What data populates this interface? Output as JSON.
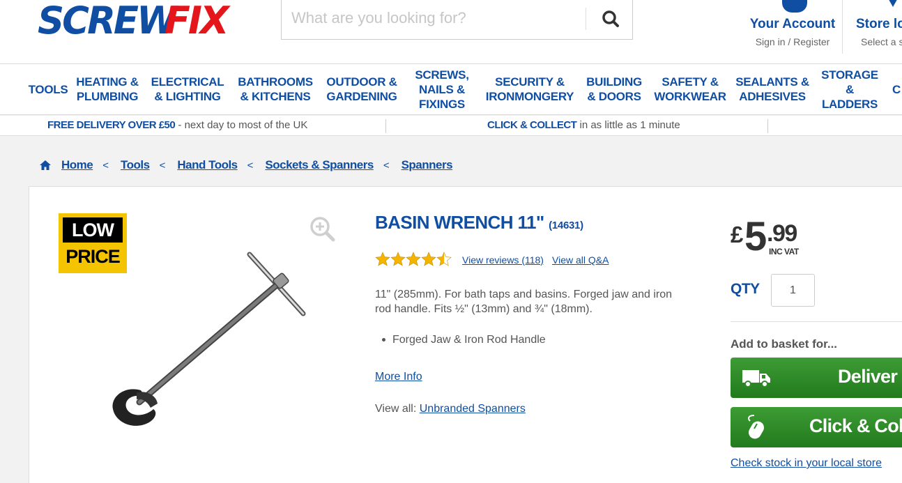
{
  "header": {
    "logo_left": "SCREW",
    "logo_right": "FIX",
    "search_placeholder": "What are you looking for?",
    "account_title": "Your Account",
    "account_sub": "Sign in / Register",
    "store_title": "Store locator",
    "store_sub": "Select a store"
  },
  "nav": {
    "items": [
      "TOOLS",
      "HEATING & PLUMBING",
      "ELECTRICAL & LIGHTING",
      "BATHROOMS & KITCHENS",
      "OUTDOOR & GARDENING",
      "SCREWS, NAILS & FIXINGS",
      "SECURITY & IRONMONGERY",
      "BUILDING & DOORS",
      "SAFETY & WORKWEAR",
      "SEALANTS & ADHESIVES",
      "STORAGE & LADDERS",
      "C"
    ]
  },
  "promo": {
    "delivery_bold": "FREE DELIVERY OVER £50",
    "delivery_rest": " - next day to most of the UK",
    "collect_bold": "CLICK & COLLECT",
    "collect_rest": " in as little as 1 minute"
  },
  "breadcrumb": {
    "items": [
      "Home",
      "Tools",
      "Hand Tools",
      "Sockets & Spanners",
      "Spanners"
    ],
    "separator": "<"
  },
  "badge": {
    "line1": "LOW",
    "line2": "PRICE"
  },
  "product": {
    "title": "BASIN WRENCH 11\"",
    "code": "(14631)",
    "rating": 4.5,
    "reviews_link": "View reviews (118)",
    "qa_link": "View all Q&A",
    "description": "11\" (285mm). For bath taps and basins. Forged jaw and iron rod handle. Fits ½\" (13mm) and ¾\" (18mm).",
    "bullets": [
      "Forged Jaw & Iron Rod Handle"
    ],
    "more_info": "More Info",
    "view_all_label": "View all: ",
    "view_all_link": "Unbranded Spanners"
  },
  "buy": {
    "currency": "£",
    "price_whole": "5",
    "price_pence": ".99",
    "vat": "INC VAT",
    "qty_label": "QTY",
    "qty_value": "1",
    "add_label": "Add to basket for...",
    "deliver_label": "Deliver",
    "collect_label": "Click & Collect",
    "check_stock": "Check stock in your local store"
  },
  "colors": {
    "brand_blue": "#0f4ea2",
    "brand_red": "#e4161b",
    "button_green": "#2e8b28",
    "badge_yellow": "#f5c400",
    "star_gold": "#f4b400"
  }
}
